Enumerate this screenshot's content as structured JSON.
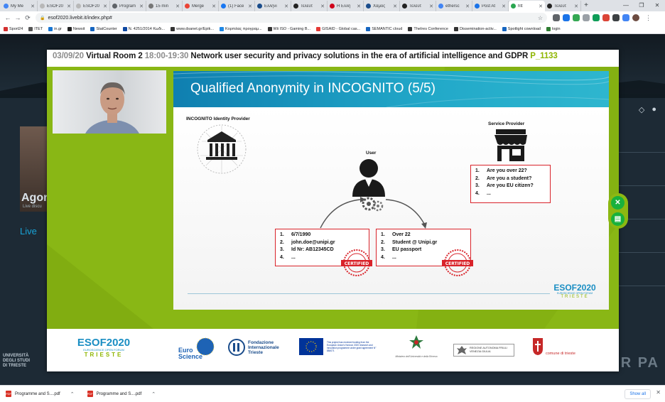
{
  "browser": {
    "tabs": [
      {
        "label": "My Me",
        "color": "#4285f4"
      },
      {
        "label": "ESOF20",
        "color": "#b8b8b8"
      },
      {
        "label": "ESOF20",
        "color": "#b8b8b8"
      },
      {
        "label": "Program",
        "color": "#5f6368"
      },
      {
        "label": "15 min",
        "color": "#777777"
      },
      {
        "label": "Merge",
        "color": "#ea4335"
      },
      {
        "label": "(1) Face",
        "color": "#1877f2"
      },
      {
        "label": "Ελληνι",
        "color": "#1a4c8b"
      },
      {
        "label": "Τελευτ",
        "color": "#222222"
      },
      {
        "label": "Η Ελλη",
        "color": "#d0021b"
      },
      {
        "label": "Χαμός",
        "color": "#1a4c8b"
      },
      {
        "label": "Τελευτ",
        "color": "#222222"
      },
      {
        "label": "ethersc",
        "color": "#4285f4"
      },
      {
        "label": "Post At",
        "color": "#1a73e8"
      },
      {
        "label": "htt",
        "color": "#2aa650"
      },
      {
        "label": "Τελευτ",
        "color": "#222222"
      }
    ],
    "active_tab_index": 14,
    "new_tab": "+",
    "url": "esof2020.livebit.it/index.php#",
    "bookmarks": [
      {
        "label": "Sport24",
        "color": "#d32f2f"
      },
      {
        "label": "ITET",
        "color": "#555555"
      },
      {
        "label": "in.gr",
        "color": "#1976d2"
      },
      {
        "label": "Newsit",
        "color": "#222222"
      },
      {
        "label": "StatCounter",
        "color": "#1565c0"
      },
      {
        "label": "N. 4251/2014 Κωδι...",
        "color": "#0d47a1"
      },
      {
        "label": "www.dsanet.gr/Epik...",
        "color": "#333333"
      },
      {
        "label": "Κορπιλας προγραμ...",
        "color": "#1e88e5"
      },
      {
        "label": "Wii ISO - Gaming B...",
        "color": "#333333"
      },
      {
        "label": "GISAID - Global cas...",
        "color": "#e53935"
      },
      {
        "label": "SEMANTIC cloud",
        "color": "#1565c0"
      },
      {
        "label": "TheIres Conference",
        "color": "#333333"
      },
      {
        "label": "Dissemination-activ...",
        "color": "#333333"
      },
      {
        "label": "Spotlight cownload",
        "color": "#1565c0"
      },
      {
        "label": "login",
        "color": "#2e7d32"
      }
    ]
  },
  "site": {
    "hero_title": "Agor",
    "hero_sub": "Live discu",
    "live_label": "Live",
    "bottom_left": "UNIVERSITÀ\nDEGLI STUDI\nDI TRIESTE",
    "bottom_right": "UR PA"
  },
  "modal": {
    "date": "03/09/20",
    "room": "Virtual Room 2",
    "time": "18:00-19:30",
    "session_title": "Network user security and privacy solutions in the era of artificial intelligence and GDPR",
    "session_code": "P_1133"
  },
  "slide": {
    "title": "Qualified Anonymity in INCOGNITO (5/5)",
    "idp_label": "INCOGNITO Identity Provider",
    "user_label": "User",
    "sp_label": "Service Provider",
    "sp_questions": [
      {
        "num": "1.",
        "text": "Are you over 22?"
      },
      {
        "num": "2.",
        "text": "Are you a student?"
      },
      {
        "num": "3.",
        "text": "Are you EU citizen?"
      },
      {
        "num": "4.",
        "text": "..."
      }
    ],
    "idp_credentials": [
      {
        "num": "1.",
        "text": "6/7/1990"
      },
      {
        "num": "2.",
        "text": "john.doe@unipi.gr"
      },
      {
        "num": "3.",
        "text": "Id Nr: AB12345CD"
      },
      {
        "num": "4.",
        "text": "..."
      }
    ],
    "derived_claims": [
      {
        "num": "1.",
        "text": "Over 22"
      },
      {
        "num": "2.",
        "text": "Student @ Unipi.gr"
      },
      {
        "num": "3.",
        "text": "EU passport"
      },
      {
        "num": "4.",
        "text": "..."
      }
    ],
    "stamp_text": "CERTIFIED",
    "logo_main": "ESOF2020",
    "logo_sub": "EUROSCIENCE OPEN FORUM",
    "logo_city": "TRIESTE"
  },
  "controls": {
    "close_symbol": "✕",
    "chat_symbol": "▤"
  },
  "sponsors": {
    "esof_main": "ESOF2020",
    "esof_sub": "EUROSCIENCE OPEN FORUM",
    "esof_city": "TRIESTE",
    "euroscience": "Euro Science",
    "fondazione_l1": "Fondazione",
    "fondazione_l2": "Internazionale",
    "fondazione_l3": "Trieste",
    "eu_text": "This project has received funding from the European Union's Horizon 2020 research and innovation programme under grant agreement N° 884071",
    "ministry": "Ministero dell'Università e della Ricerca",
    "fvg": "REGIONE AUTONOMA FRIULI VENEZIA GIULIA",
    "comune": "comune di trieste"
  },
  "downloads": {
    "items": [
      {
        "name": "Programme and S....pdf"
      },
      {
        "name": "Programme and S....pdf"
      }
    ],
    "show_all": "Show all"
  },
  "colors": {
    "player_green": "#89b715",
    "slide_blue": "#1a9ac4",
    "accent_red": "#d9232a",
    "control_green": "#19b13c"
  }
}
